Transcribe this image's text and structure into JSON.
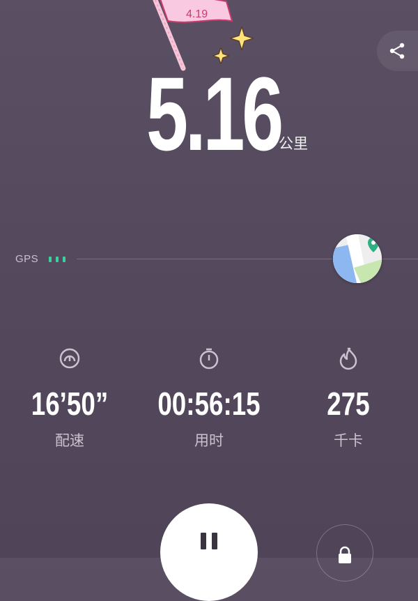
{
  "flag": {
    "text": "4.19"
  },
  "distance": {
    "value": "5.16",
    "unit": "公里"
  },
  "gps": {
    "label": "GPS",
    "signal_bars": 3,
    "color": "#3ad0a0"
  },
  "stats": [
    {
      "icon": "pace-icon",
      "value": "16’50”",
      "label": "配速"
    },
    {
      "icon": "stopwatch-icon",
      "value": "00:56:15",
      "label": "用时"
    },
    {
      "icon": "flame-icon",
      "value": "275",
      "label": "千卡"
    }
  ],
  "controls": {
    "pause": "pause-icon",
    "lock": "lock-icon",
    "share": "share-icon",
    "map": "map-icon"
  }
}
